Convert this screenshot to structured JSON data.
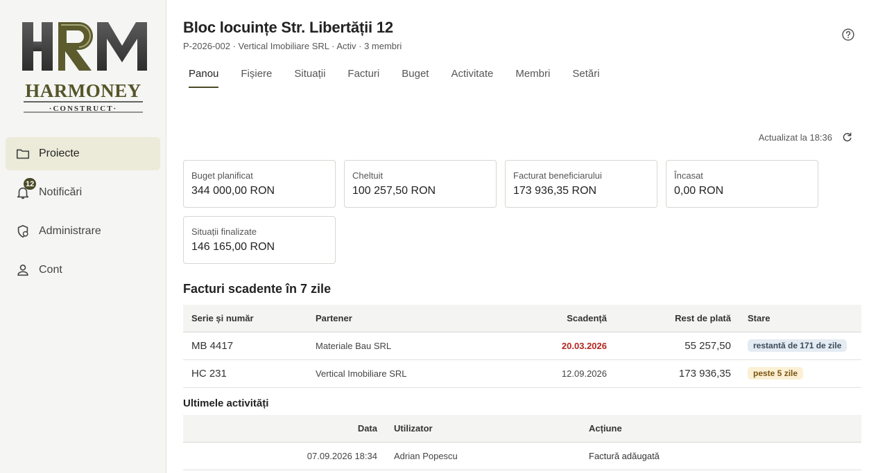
{
  "sidebar": {
    "logo_text": "HRM HARMONEY CONSTRUCT",
    "items": [
      {
        "label": "Proiecte",
        "icon": "folder-icon",
        "active": true
      },
      {
        "label": "Notificări",
        "icon": "bell-icon",
        "badge": "12"
      },
      {
        "label": "Administrare",
        "icon": "shield-gear-icon"
      },
      {
        "label": "Cont",
        "icon": "user-icon"
      }
    ]
  },
  "header": {
    "title": "Bloc locuințe Str. Libertății 12",
    "subtitle": "P-2026-002 · Vertical Imobiliare SRL · Activ · 3 membri"
  },
  "tabs": [
    "Panou",
    "Fișiere",
    "Situații",
    "Facturi",
    "Buget",
    "Activitate",
    "Membri",
    "Setări"
  ],
  "updated_text": "Actualizat la 18:36",
  "cards": [
    {
      "label": "Buget planificat",
      "value": "344 000,00 RON"
    },
    {
      "label": "Cheltuit",
      "value": "100 257,50 RON"
    },
    {
      "label": "Facturat beneficiarului",
      "value": "173 936,35 RON"
    },
    {
      "label": "Încasat",
      "value": "0,00 RON"
    },
    {
      "label": "Situații finalizate",
      "value": "146 165,00 RON"
    }
  ],
  "invoices": {
    "title": "Facturi scadente în 7 zile",
    "columns": [
      "Serie și număr",
      "Partener",
      "Scadență",
      "Rest de plată",
      "Stare"
    ],
    "rows": [
      {
        "number": "MB 4417",
        "partner": "Materiale Bau SRL",
        "due": "20.03.2026",
        "rest": "55 257,50",
        "status": "restantă de 171 de zile"
      },
      {
        "number": "HC 231",
        "partner": "Vertical Imobiliare SRL",
        "due": "12.09.2026",
        "rest": "173 936,35",
        "status": "peste 5 zile"
      }
    ]
  },
  "activity": {
    "title": "Ultimele activități",
    "columns": [
      "Data",
      "Utilizator",
      "Acțiune"
    ],
    "rows": [
      {
        "date": "07.09.2026 18:34",
        "user": "Adrian Popescu",
        "action": "Factură adăugată"
      }
    ]
  },
  "colors": {
    "accent": "#4a4a28",
    "overdue": "#b3261e"
  }
}
